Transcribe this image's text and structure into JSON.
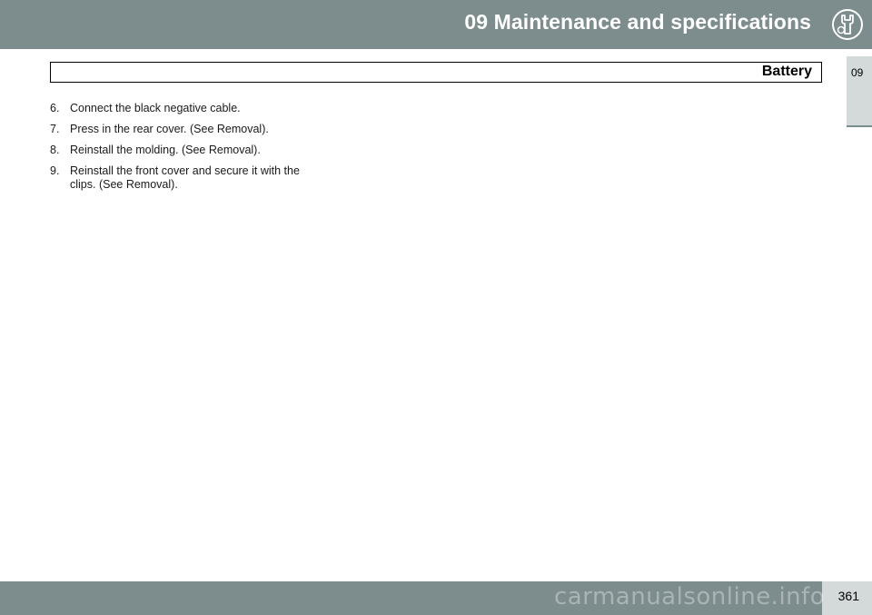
{
  "header": {
    "title": "09 Maintenance and specifications",
    "icon": "wrench-icon"
  },
  "side_tab": {
    "label": "09"
  },
  "section": {
    "title": "Battery"
  },
  "steps": [
    {
      "num": "6.",
      "text": "Connect the black negative cable."
    },
    {
      "num": "7.",
      "text": "Press in the rear cover. (See Removal)."
    },
    {
      "num": "8.",
      "text": "Reinstall the molding. (See Removal)."
    },
    {
      "num": "9.",
      "text": "Reinstall the front cover and secure it with the clips. (See Removal)."
    }
  ],
  "footer": {
    "page_number": "361"
  },
  "watermark": {
    "text": "carmanualsonline.info"
  },
  "colors": {
    "bar": "#7d8c8c",
    "tab": "#d4dada"
  }
}
